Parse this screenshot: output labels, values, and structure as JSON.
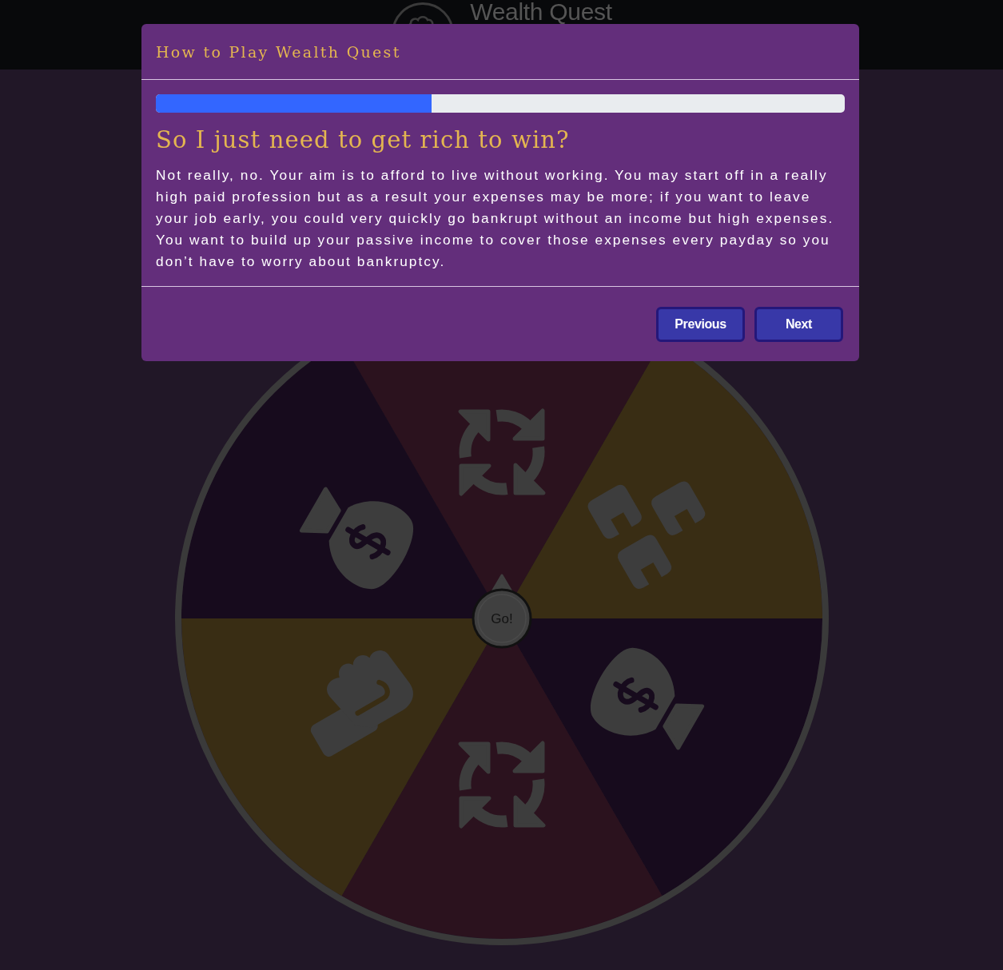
{
  "header": {
    "title": "Wealth Quest"
  },
  "modal": {
    "title": "How to Play Wealth Quest",
    "progress": {
      "level": 0.4
    },
    "heading": "So I just need to get rich to win?",
    "text": "Not really, no. Your aim is to afford to live without working. You may start off in a really high paid profession but as a result your expenses may be more; if you want to leave your job early, you could very quickly go bankrupt without an income but high expenses. You want to build up your passive income to cover those expenses every payday so you don’t have to worry about bankruptcy.",
    "buttons": [
      {
        "label": "Previous"
      },
      {
        "label": "Next"
      }
    ]
  },
  "wheel": {
    "segments": [
      {
        "kind": "cycle",
        "color": "#2b121e"
      },
      {
        "kind": "blocks",
        "color": "#392d14"
      },
      {
        "kind": "bag",
        "color": "#170b1d"
      },
      {
        "kind": "cycle",
        "color": "#2b121e"
      },
      {
        "kind": "cash",
        "color": "#392d14"
      },
      {
        "kind": "bag",
        "color": "#170b1d"
      }
    ],
    "spin_label": "Go!"
  }
}
